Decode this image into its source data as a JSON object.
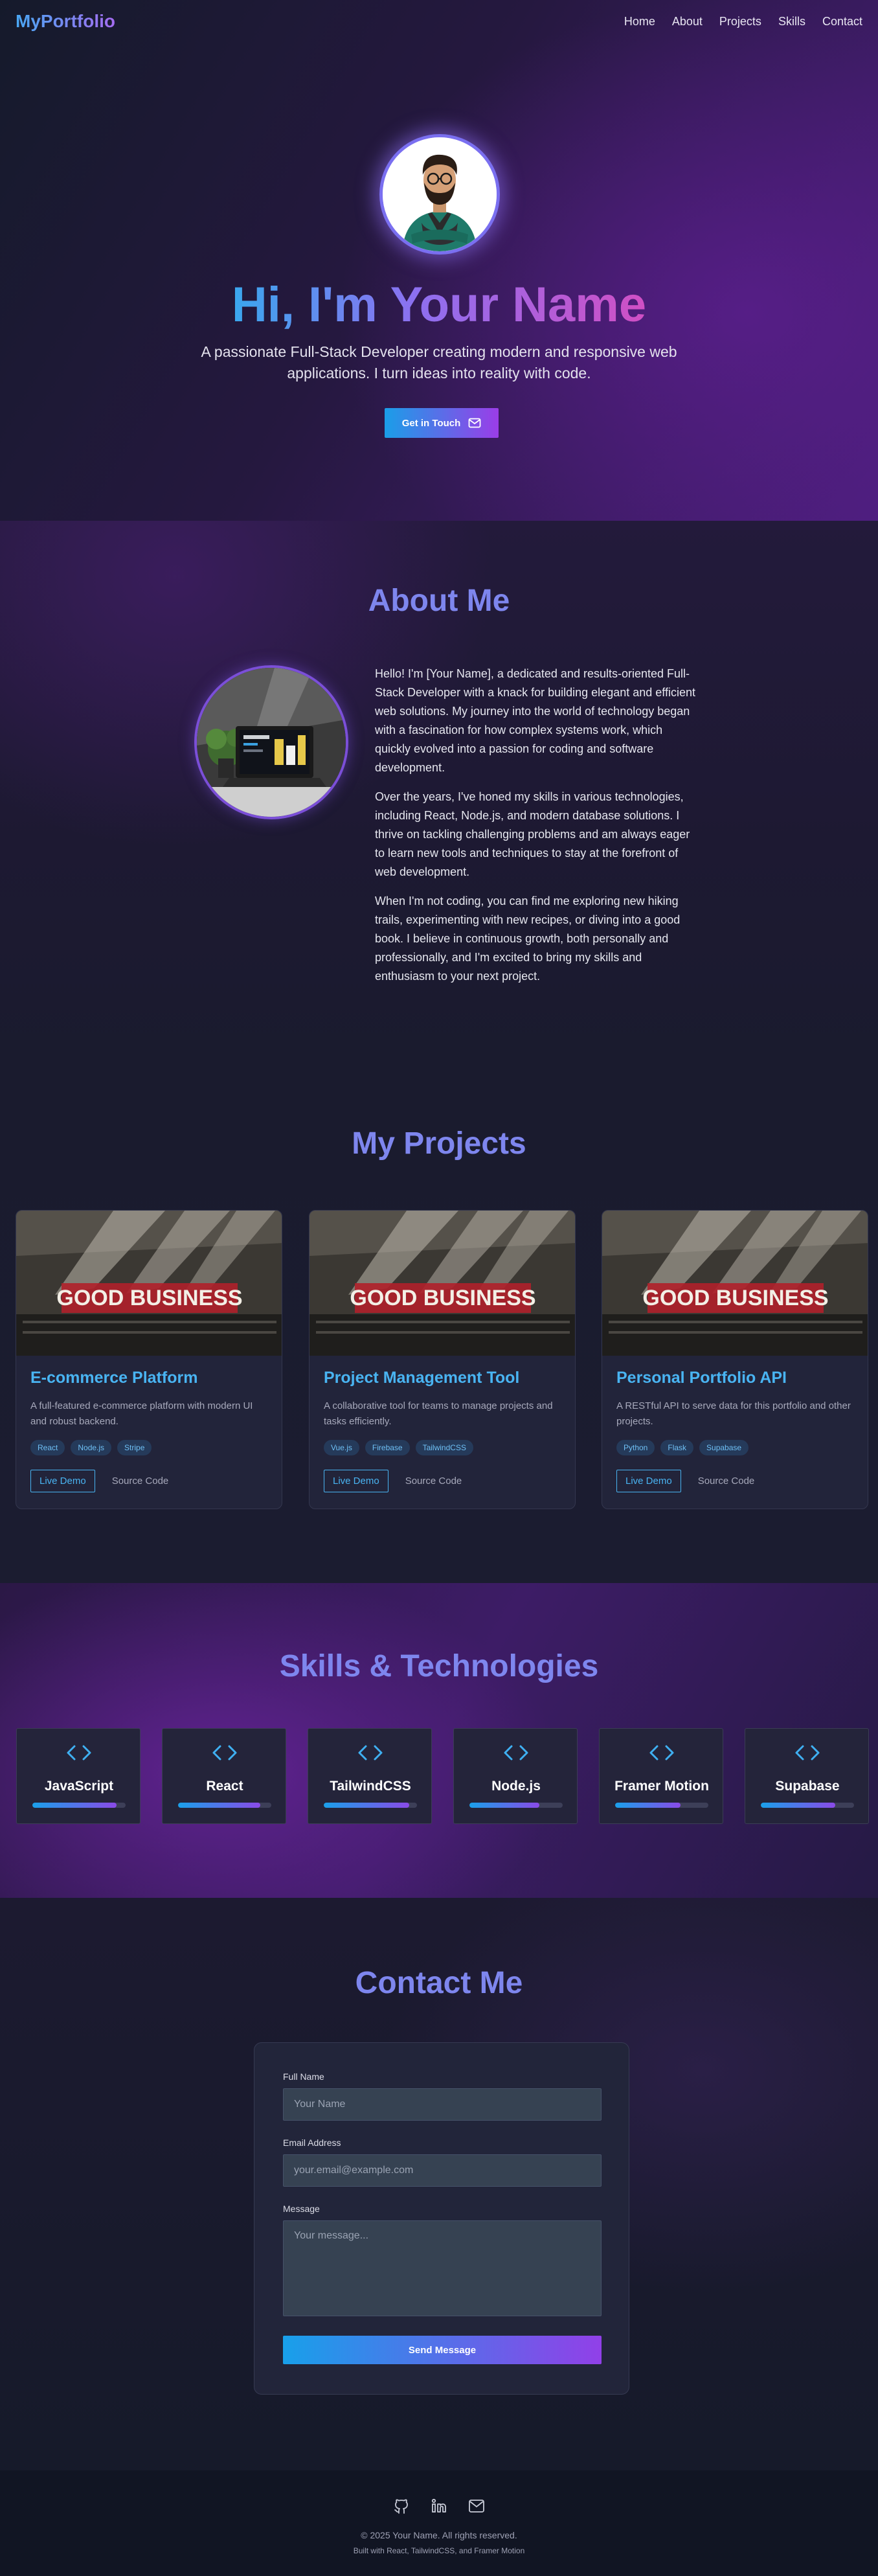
{
  "nav": {
    "logo": "MyPortfolio",
    "links": [
      "Home",
      "About",
      "Projects",
      "Skills",
      "Contact"
    ]
  },
  "hero": {
    "title": "Hi, I'm Your Name",
    "subtitle": "A passionate Full-Stack Developer creating modern and responsive web applications. I turn ideas into reality with code.",
    "cta_label": "Get in Touch",
    "cta_icon": "mail-icon"
  },
  "about": {
    "title": "About Me",
    "paragraphs": [
      "Hello! I'm [Your Name], a dedicated and results-oriented Full-Stack Developer with a knack for building elegant and efficient web solutions. My journey into the world of technology began with a fascination for how complex systems work, which quickly evolved into a passion for coding and software development.",
      "Over the years, I've honed my skills in various technologies, including React, Node.js, and modern database solutions. I thrive on tackling challenging problems and am always eager to learn new tools and techniques to stay at the forefront of web development.",
      "When I'm not coding, you can find me exploring new hiking trails, experimenting with new recipes, or diving into a good book. I believe in continuous growth, both personally and professionally, and I'm excited to bring my skills and enthusiasm to your next project."
    ]
  },
  "projects": {
    "title": "My Projects",
    "image_caption": "GOOD BUSINESS",
    "items": [
      {
        "title": "E-commerce Platform",
        "description": "A full-featured e-commerce platform with modern UI and robust backend.",
        "tags": [
          "React",
          "Node.js",
          "Stripe"
        ],
        "demo_label": "Live Demo",
        "source_label": "Source Code"
      },
      {
        "title": "Project Management Tool",
        "description": "A collaborative tool for teams to manage projects and tasks efficiently.",
        "tags": [
          "Vue.js",
          "Firebase",
          "TailwindCSS"
        ],
        "demo_label": "Live Demo",
        "source_label": "Source Code"
      },
      {
        "title": "Personal Portfolio API",
        "description": "A RESTful API to serve data for this portfolio and other projects.",
        "tags": [
          "Python",
          "Flask",
          "Supabase"
        ],
        "demo_label": "Live Demo",
        "source_label": "Source Code"
      }
    ]
  },
  "skills": {
    "title": "Skills & Technologies",
    "icon": "code-icon",
    "items": [
      {
        "name": "JavaScript",
        "level": 0.9
      },
      {
        "name": "React",
        "level": 0.88
      },
      {
        "name": "TailwindCSS",
        "level": 0.92
      },
      {
        "name": "Node.js",
        "level": 0.75
      },
      {
        "name": "Framer Motion",
        "level": 0.7
      },
      {
        "name": "Supabase",
        "level": 0.8
      }
    ]
  },
  "contact": {
    "title": "Contact Me",
    "name_label": "Full Name",
    "name_placeholder": "Your Name",
    "email_label": "Email Address",
    "email_placeholder": "your.email@example.com",
    "message_label": "Message",
    "message_placeholder": "Your message...",
    "submit_label": "Send Message"
  },
  "footer": {
    "icons": [
      "github-icon",
      "linkedin-icon",
      "mail-icon"
    ],
    "copyright": "© 2025 Your Name. All rights reserved.",
    "built_with": "Built with React, TailwindCSS, and Framer Motion"
  },
  "colors": {
    "accent_blue": "#49b4f2",
    "accent_purple": "#8e6ff0",
    "title_purple": "#7e86ee"
  }
}
